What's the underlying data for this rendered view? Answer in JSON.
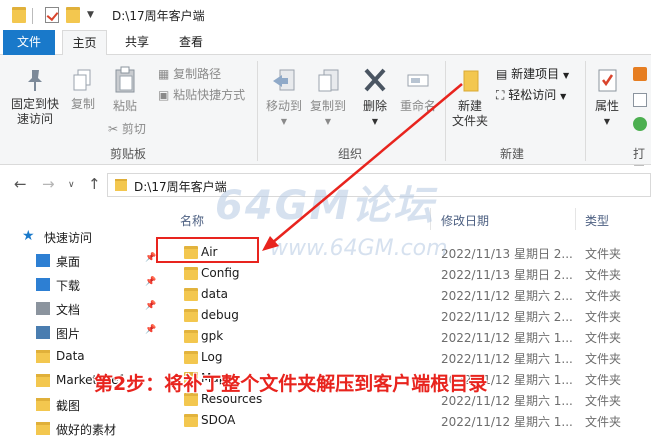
{
  "window": {
    "title": "D:\\17周年客户端"
  },
  "tabs": {
    "file": "文件",
    "home": "主页",
    "share": "共享",
    "view": "查看"
  },
  "ribbon": {
    "clipboard": {
      "pin": "固定到快\n速访问",
      "copy": "复制",
      "paste": "粘贴",
      "copy_path": "复制路径",
      "paste_shortcut": "粘贴快捷方式",
      "cut": "剪切",
      "label": "剪贴板"
    },
    "organize": {
      "move_to": "移动到",
      "copy_to": "复制到",
      "delete": "删除",
      "rename": "重命名",
      "label": "组织"
    },
    "new": {
      "new_folder": "新建\n文件夹",
      "new_item": "新建项目",
      "easy_access": "轻松访问",
      "label": "新建"
    },
    "open": {
      "properties": "属性",
      "label": "打开"
    }
  },
  "address": {
    "path": "D:\\17周年客户端"
  },
  "nav_pane": {
    "quick_access": "快速访问",
    "items": [
      {
        "label": "桌面",
        "icon": "desktop-icon",
        "pinned": true
      },
      {
        "label": "下载",
        "icon": "download-icon",
        "pinned": true
      },
      {
        "label": "文档",
        "icon": "document-icon",
        "pinned": true
      },
      {
        "label": "图片",
        "icon": "picture-icon",
        "pinned": true
      },
      {
        "label": "Data",
        "icon": "folder-icon",
        "pinned": false
      },
      {
        "label": "Market Tref",
        "icon": "folder-icon",
        "pinned": false
      },
      {
        "label": "截图",
        "icon": "folder-icon",
        "pinned": false
      },
      {
        "label": "做好的素材",
        "icon": "folder-icon",
        "pinned": false
      }
    ]
  },
  "file_list": {
    "columns": {
      "name": "名称",
      "date": "修改日期",
      "type": "类型"
    },
    "rows": [
      {
        "name": "Air",
        "date": "2022/11/13 星期日 2...",
        "type": "文件夹"
      },
      {
        "name": "Config",
        "date": "2022/11/13 星期日 2...",
        "type": "文件夹"
      },
      {
        "name": "data",
        "date": "2022/11/12 星期六 2...",
        "type": "文件夹"
      },
      {
        "name": "debug",
        "date": "2022/11/12 星期六 2...",
        "type": "文件夹"
      },
      {
        "name": "gpk",
        "date": "2022/11/12 星期六 1...",
        "type": "文件夹"
      },
      {
        "name": "Log",
        "date": "2022/11/12 星期六 1...",
        "type": "文件夹"
      },
      {
        "name": "Map",
        "date": "2022/11/12 星期六 1...",
        "type": "文件夹"
      },
      {
        "name": "Resources",
        "date": "2022/11/12 星期六 1...",
        "type": "文件夹"
      },
      {
        "name": "SDOA",
        "date": "2022/11/12 星期六 1...",
        "type": "文件夹"
      }
    ]
  },
  "overlay": {
    "watermark": "64GM论坛",
    "watermark_url": "www.64GM.com",
    "caption": "第2步：将补丁整个文件夹解压到客户端根目录",
    "annotation_color": "#e8241e"
  },
  "colors": {
    "accent": "#1979ca",
    "folder": "#f3c74f"
  }
}
